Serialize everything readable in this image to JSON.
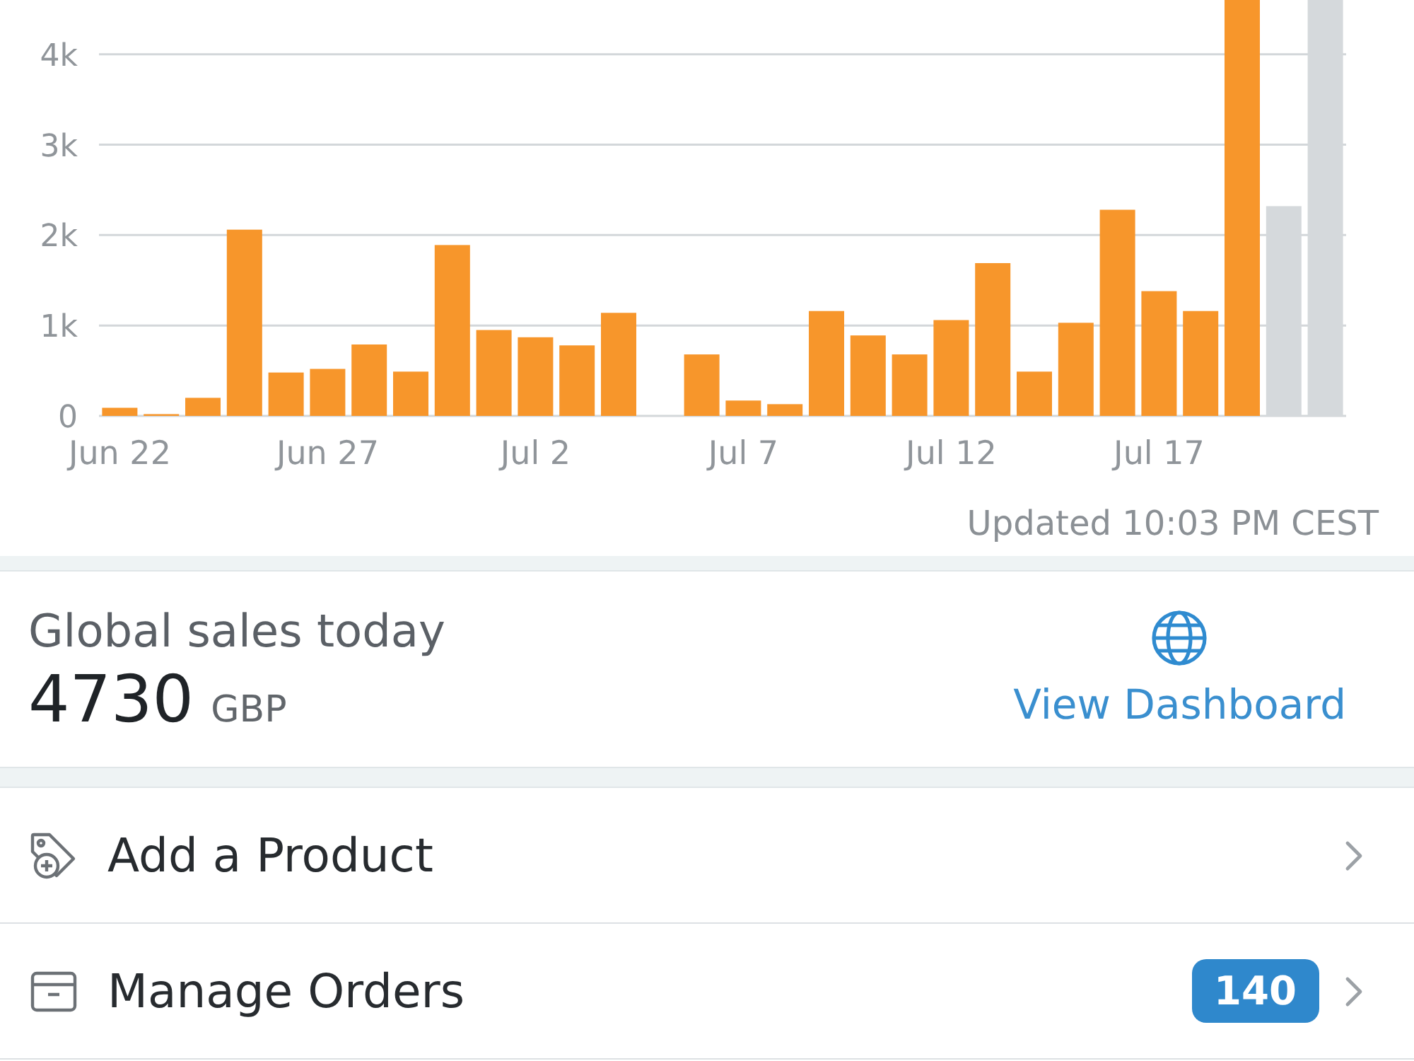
{
  "chart": {
    "chart_data": {
      "type": "bar",
      "categories": [
        "Jun 22",
        null,
        null,
        null,
        null,
        "Jun 27",
        null,
        null,
        null,
        null,
        "Jul 2",
        null,
        null,
        null,
        null,
        "Jul 7",
        null,
        null,
        null,
        null,
        "Jul 12",
        null,
        null,
        null,
        null,
        "Jul 17",
        null,
        null,
        null,
        null
      ],
      "series": [
        {
          "color": "#f7962b",
          "values": [
            90,
            20,
            200,
            2060,
            480,
            520,
            790,
            490,
            1890,
            950,
            870,
            780,
            1140,
            0,
            680,
            170,
            130,
            1160,
            890,
            680,
            1060,
            1690,
            490,
            1030,
            2280,
            1380,
            1160,
            4600,
            null,
            null
          ]
        },
        {
          "color": "#d5d9dc",
          "values": [
            null,
            null,
            null,
            null,
            null,
            null,
            null,
            null,
            null,
            null,
            null,
            null,
            null,
            null,
            null,
            null,
            null,
            null,
            null,
            null,
            null,
            null,
            null,
            null,
            null,
            null,
            null,
            null,
            2320,
            4600
          ]
        }
      ],
      "ylim": [
        0,
        4600
      ],
      "yticks": [
        0,
        {
          "value": 1000,
          "label": "1k"
        },
        {
          "value": 2000,
          "label": "2k"
        },
        {
          "value": 3000,
          "label": "3k"
        },
        {
          "value": 4000,
          "label": "4k"
        }
      ],
      "grid": true
    },
    "updated": "Updated 10:03 PM CEST"
  },
  "sales": {
    "label": "Global sales today",
    "amount": "4730",
    "currency": "GBP",
    "link": "View Dashboard"
  },
  "actions": [
    {
      "kind": "product",
      "label": "Add a Product"
    },
    {
      "kind": "orders",
      "label": "Manage Orders",
      "badge": "140"
    }
  ]
}
